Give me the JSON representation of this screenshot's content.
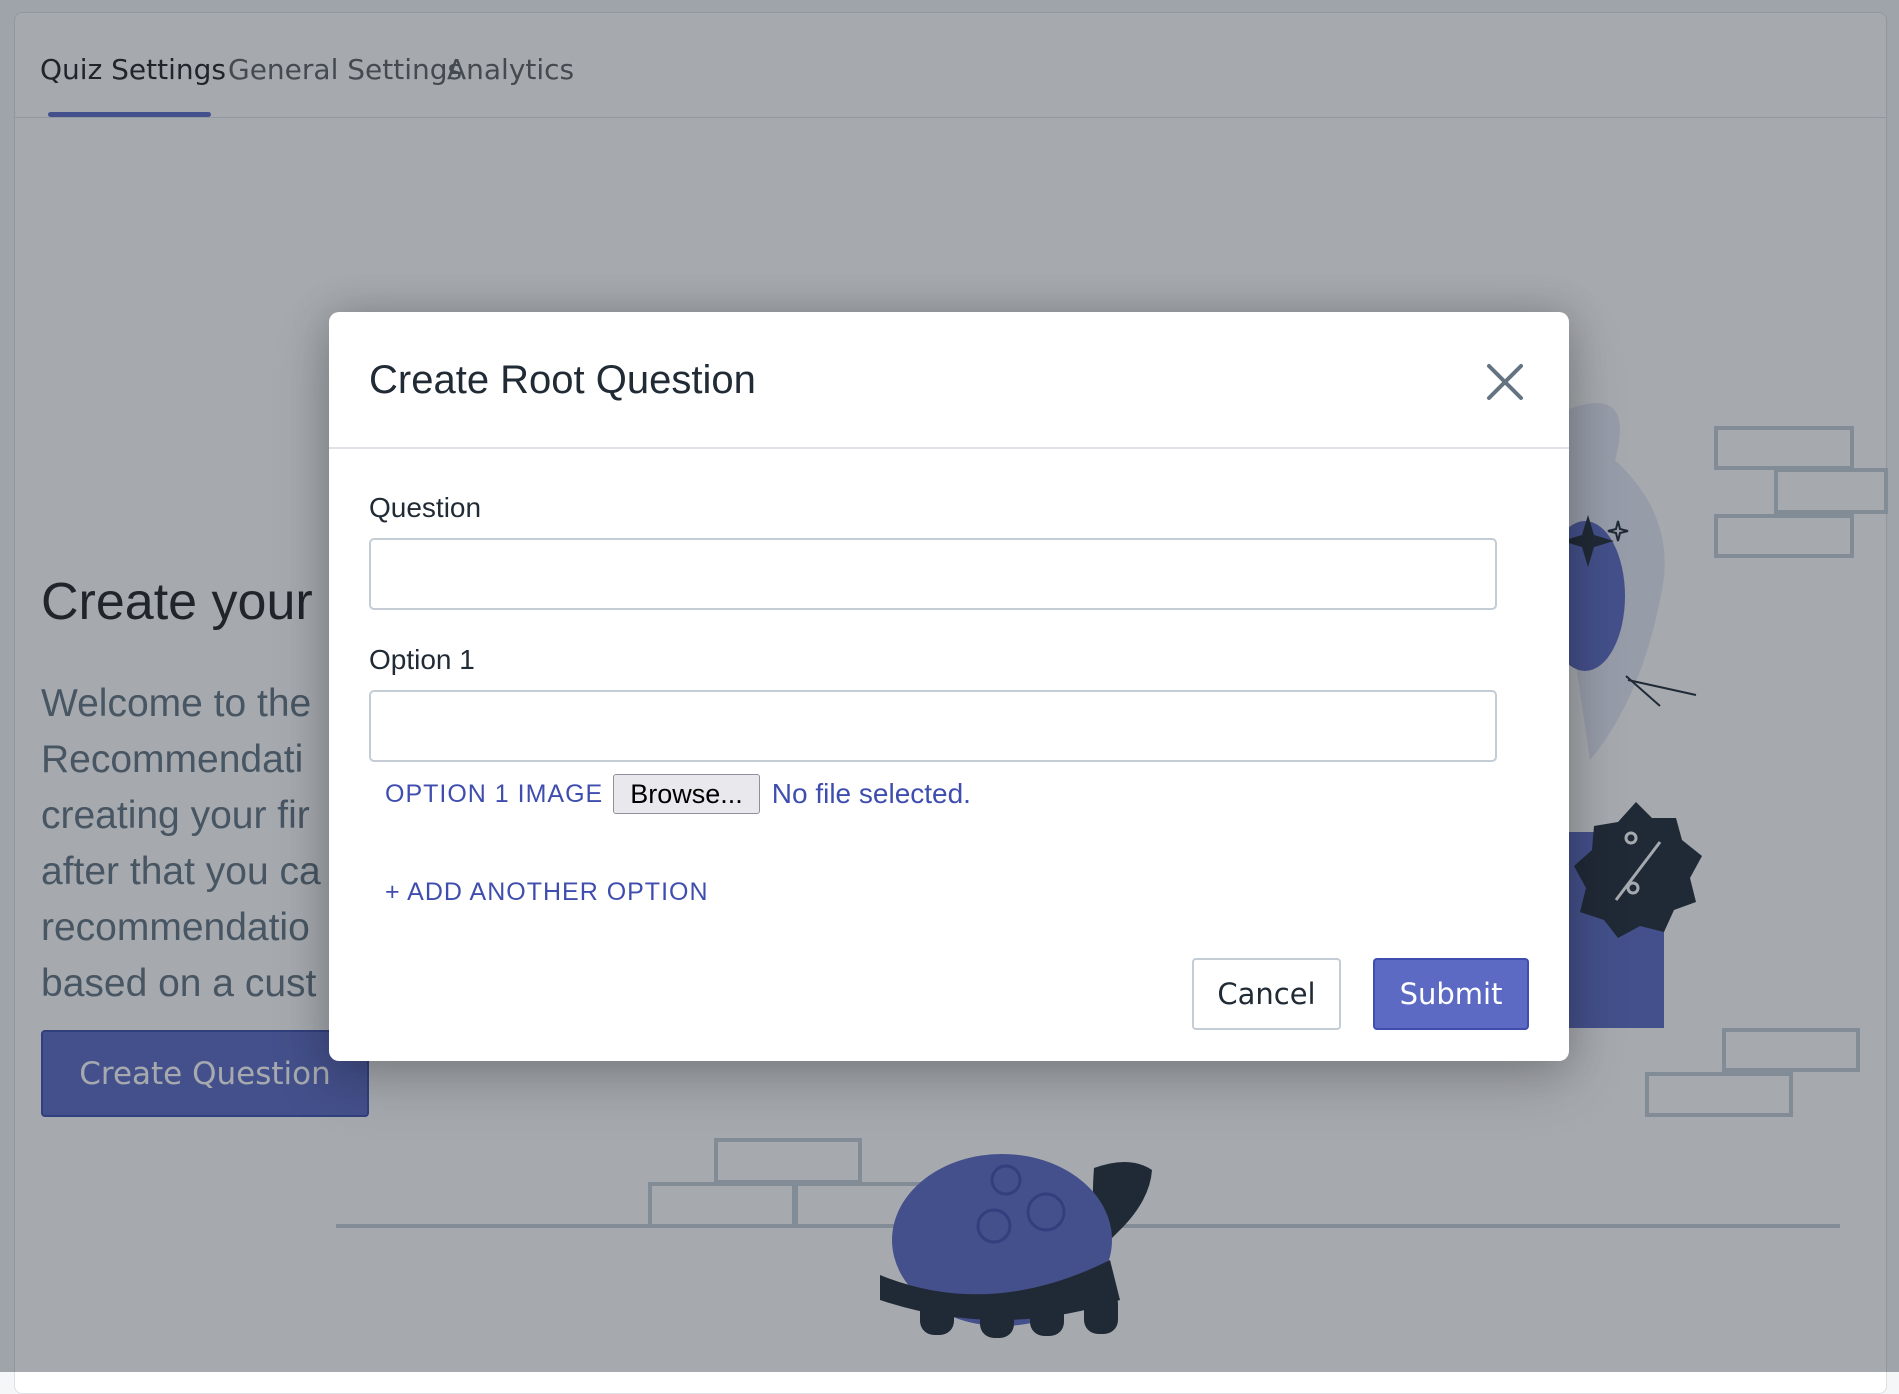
{
  "tabs": [
    {
      "label": "Quiz Settings",
      "active": true
    },
    {
      "label": "General Settings",
      "active": false
    },
    {
      "label": "Analytics",
      "active": false
    }
  ],
  "empty_state": {
    "title": "Create your",
    "body": "Welcome to the\nRecommendati\ncreating your fir\nafter that you ca\nrecommendatio\nbased on a cust",
    "button_label": "Create Question"
  },
  "modal": {
    "title": "Create Root Question",
    "question_label": "Question",
    "question_value": "",
    "option1_label": "Option 1",
    "option1_value": "",
    "option1_image_label": "OPTION 1 IMAGE",
    "browse_label": "Browse...",
    "file_status": "No file selected.",
    "add_option_label": "+ ADD ANOTHER OPTION",
    "cancel_label": "Cancel",
    "submit_label": "Submit"
  },
  "colors": {
    "accent": "#5c6ac4",
    "accent_dark": "#3f4eae",
    "backdrop": "#212b36"
  },
  "icons": {
    "close": "close-icon",
    "illustration": "turtle-illustration"
  }
}
